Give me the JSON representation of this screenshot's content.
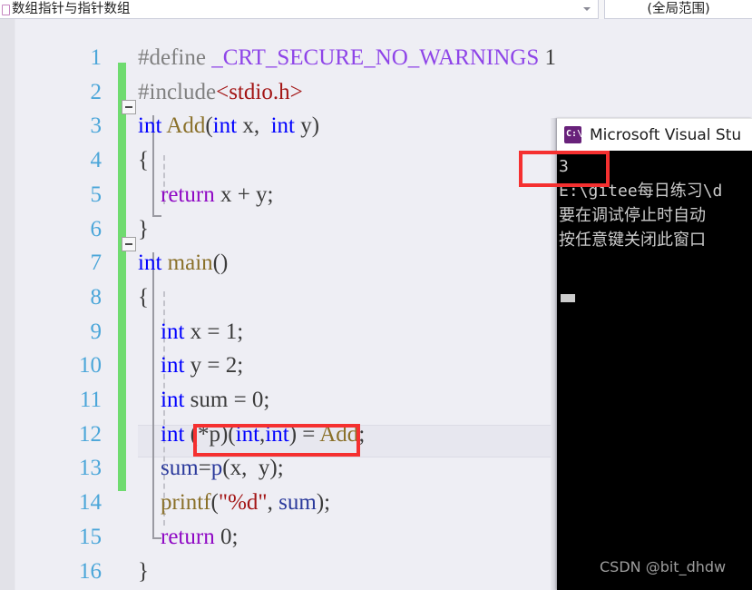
{
  "topbar": {
    "left_combo": {
      "icon": "file-document-icon",
      "value": "数组指针与指针数组",
      "arrow_icon": "chevron-down-icon"
    },
    "right_combo": {
      "value": "(全局范围)"
    }
  },
  "editor": {
    "line_numbers": [
      "1",
      "2",
      "3",
      "4",
      "5",
      "6",
      "7",
      "8",
      "9",
      "10",
      "11",
      "12",
      "13",
      "14",
      "15",
      "16"
    ],
    "lines": [
      {
        "n": 1,
        "tokens": [
          {
            "t": "#define ",
            "c": "t-pp"
          },
          {
            "t": "_CRT_SECURE_NO_WARNINGS",
            "c": "t-mac"
          },
          {
            "t": " 1",
            "c": "t-pun"
          }
        ]
      },
      {
        "n": 2,
        "tokens": [
          {
            "t": "#include",
            "c": "t-pp"
          },
          {
            "t": "<stdio.h>",
            "c": "t-str"
          }
        ]
      },
      {
        "n": 3,
        "tokens": [
          {
            "t": "int",
            "c": "t-kw"
          },
          {
            "t": " ",
            "c": "t-pun"
          },
          {
            "t": "Add",
            "c": "t-fn"
          },
          {
            "t": "(",
            "c": "t-pun"
          },
          {
            "t": "int",
            "c": "t-kw"
          },
          {
            "t": " x,  ",
            "c": "t-pun"
          },
          {
            "t": "int",
            "c": "t-kw"
          },
          {
            "t": " y)",
            "c": "t-pun"
          }
        ]
      },
      {
        "n": 4,
        "tokens": [
          {
            "t": "{",
            "c": "t-pun"
          }
        ]
      },
      {
        "n": 5,
        "tokens": [
          {
            "t": "    ",
            "c": "t-pun"
          },
          {
            "t": "return",
            "c": "t-ctl"
          },
          {
            "t": " x + y;",
            "c": "t-pun"
          }
        ]
      },
      {
        "n": 6,
        "tokens": [
          {
            "t": "}",
            "c": "t-pun"
          }
        ]
      },
      {
        "n": 7,
        "tokens": [
          {
            "t": "int",
            "c": "t-kw"
          },
          {
            "t": " ",
            "c": "t-pun"
          },
          {
            "t": "main",
            "c": "t-fn"
          },
          {
            "t": "()",
            "c": "t-pun"
          }
        ]
      },
      {
        "n": 8,
        "tokens": [
          {
            "t": "{",
            "c": "t-pun"
          }
        ]
      },
      {
        "n": 9,
        "tokens": [
          {
            "t": "    ",
            "c": "t-pun"
          },
          {
            "t": "int",
            "c": "t-kw"
          },
          {
            "t": " x = 1;",
            "c": "t-pun"
          }
        ]
      },
      {
        "n": 10,
        "tokens": [
          {
            "t": "    ",
            "c": "t-pun"
          },
          {
            "t": "int",
            "c": "t-kw"
          },
          {
            "t": " y = 2;",
            "c": "t-pun"
          }
        ]
      },
      {
        "n": 11,
        "tokens": [
          {
            "t": "    ",
            "c": "t-pun"
          },
          {
            "t": "int",
            "c": "t-kw"
          },
          {
            "t": " sum = 0;",
            "c": "t-pun"
          }
        ]
      },
      {
        "n": 12,
        "tokens": [
          {
            "t": "    ",
            "c": "t-pun"
          },
          {
            "t": "int",
            "c": "t-kw"
          },
          {
            "t": " (*p)(",
            "c": "t-pun"
          },
          {
            "t": "int",
            "c": "t-kw"
          },
          {
            "t": ",",
            "c": "t-pun"
          },
          {
            "t": "int",
            "c": "t-kw"
          },
          {
            "t": ") = ",
            "c": "t-pun"
          },
          {
            "t": "Add",
            "c": "t-fn"
          },
          {
            "t": ";",
            "c": "t-pun"
          }
        ]
      },
      {
        "n": 13,
        "tokens": [
          {
            "t": "    ",
            "c": "t-pun"
          },
          {
            "t": "sum",
            "c": "t-var"
          },
          {
            "t": "=",
            "c": "t-pun"
          },
          {
            "t": "p",
            "c": "t-var"
          },
          {
            "t": "(x,  y);",
            "c": "t-pun"
          }
        ]
      },
      {
        "n": 14,
        "tokens": [
          {
            "t": "    ",
            "c": "t-pun"
          },
          {
            "t": "printf",
            "c": "t-fn"
          },
          {
            "t": "(",
            "c": "t-pun"
          },
          {
            "t": "\"%d\"",
            "c": "t-str"
          },
          {
            "t": ", ",
            "c": "t-pun"
          },
          {
            "t": "sum",
            "c": "t-var"
          },
          {
            "t": ");",
            "c": "t-pun"
          }
        ]
      },
      {
        "n": 15,
        "tokens": [
          {
            "t": "    ",
            "c": "t-pun"
          },
          {
            "t": "return",
            "c": "t-ctl"
          },
          {
            "t": " 0;",
            "c": "t-pun"
          }
        ]
      },
      {
        "n": 16,
        "tokens": [
          {
            "t": "}",
            "c": "t-pun"
          }
        ]
      }
    ],
    "collapse_icons": [
      "collapse-minus-icon",
      "collapse-minus-icon"
    ],
    "change_bar_color": "#6fdb6f"
  },
  "console": {
    "title": "Microsoft Visual Stu",
    "icon": "command-prompt-icon",
    "lines": [
      "3",
      "E:\\gitee每日练习\\d",
      "要在调试停止时自动",
      "按任意键关闭此窗口"
    ],
    "caret": "block-cursor"
  },
  "annotations": {
    "red_boxes": [
      {
        "name": "highlight-call-line",
        "target": "sum=p(x,  y);"
      },
      {
        "name": "highlight-console-output",
        "target": "3"
      }
    ],
    "accent_color": "#f53030"
  },
  "watermark": {
    "text": "CSDN @bit_dhdw"
  }
}
